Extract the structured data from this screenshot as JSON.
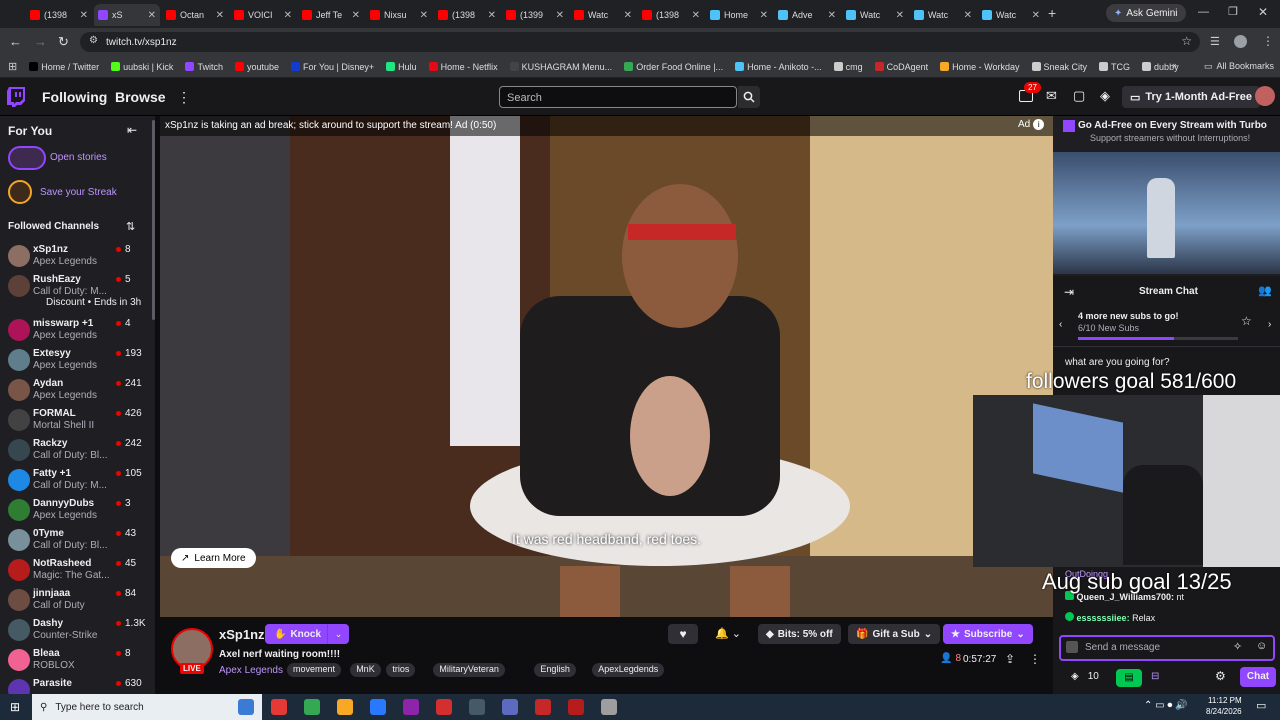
{
  "browser": {
    "tabs": [
      {
        "label": "(1398",
        "color": "#ff0000"
      },
      {
        "label": "xS",
        "color": "#9146ff",
        "active": true
      },
      {
        "label": "Octan",
        "color": "#ff0000"
      },
      {
        "label": "VOICI",
        "color": "#ff0000"
      },
      {
        "label": "Jeff Te",
        "color": "#ff0000"
      },
      {
        "label": "Nixsu",
        "color": "#ff0000"
      },
      {
        "label": "(1398",
        "color": "#ff0000"
      },
      {
        "label": "(1399",
        "color": "#ff0000"
      },
      {
        "label": "Watc",
        "color": "#ff0000"
      },
      {
        "label": "(1398",
        "color": "#ff0000"
      },
      {
        "label": "Home",
        "color": "#4fc3f7"
      },
      {
        "label": "Adve",
        "color": "#4fc3f7"
      },
      {
        "label": "Watc",
        "color": "#4fc3f7"
      },
      {
        "label": "Watc",
        "color": "#4fc3f7"
      },
      {
        "label": "Watc",
        "color": "#4fc3f7"
      }
    ],
    "ask_gemini": "Ask Gemini",
    "url": "twitch.tv/xsp1nz",
    "bookmarks": [
      {
        "label": "Home / Twitter",
        "color": "#000000"
      },
      {
        "label": "uubski | Kick",
        "color": "#53fc18"
      },
      {
        "label": "Twitch",
        "color": "#9146ff"
      },
      {
        "label": "youtube",
        "color": "#ff0000"
      },
      {
        "label": "For You | Disney+",
        "color": "#113ccf"
      },
      {
        "label": "Hulu",
        "color": "#1ce783"
      },
      {
        "label": "Home - Netflix",
        "color": "#e50914"
      },
      {
        "label": "KUSHAGRAM Menu...",
        "color": "#444444"
      },
      {
        "label": "Order Food Online |...",
        "color": "#34a853"
      },
      {
        "label": "Home - Anikoto -...",
        "color": "#4fc3f7"
      },
      {
        "label": "cmg",
        "color": "#cccccc"
      },
      {
        "label": "CoDAgent",
        "color": "#c62828"
      },
      {
        "label": "Home - Workday",
        "color": "#f9a825"
      },
      {
        "label": "Sneak City",
        "color": "#cccccc"
      },
      {
        "label": "TCG",
        "color": "#cccccc"
      },
      {
        "label": "dubby",
        "color": "#cccccc"
      }
    ],
    "all_bookmarks": "All Bookmarks"
  },
  "nav": {
    "following": "Following",
    "browse": "Browse",
    "search_placeholder": "Search",
    "notif_count": "27",
    "turbo": "Try 1-Month Ad-Free"
  },
  "sidebar": {
    "for_you": "For You",
    "open_stories": "Open stories",
    "save_streak": "Save your Streak",
    "followed": "Followed Channels",
    "channels": [
      {
        "name": "xSp1nz",
        "game": "Apex Legends",
        "viewers": "8",
        "color": "#8d6e63"
      },
      {
        "name": "RushEazy",
        "game": "Call of Duty: M...",
        "viewers": "5",
        "color": "#5d4037",
        "extra": "Discount • Ends in 3h"
      },
      {
        "name": "misswarp +1",
        "game": "Apex Legends",
        "viewers": "4",
        "color": "#ad1457"
      },
      {
        "name": "Extesyy",
        "game": "Apex Legends",
        "viewers": "193",
        "color": "#607d8b"
      },
      {
        "name": "Aydan",
        "game": "Apex Legends",
        "viewers": "241",
        "color": "#795548"
      },
      {
        "name": "FORMAL",
        "game": "Mortal Shell II",
        "viewers": "426",
        "color": "#424242"
      },
      {
        "name": "Rackzy",
        "game": "Call of Duty: Bl...",
        "viewers": "242",
        "color": "#37474f"
      },
      {
        "name": "Fatty +1",
        "game": "Call of Duty: M...",
        "viewers": "105",
        "color": "#1e88e5"
      },
      {
        "name": "DannyyDubs",
        "game": "Apex Legends",
        "viewers": "3",
        "color": "#2e7d32"
      },
      {
        "name": "0Tyme",
        "game": "Call of Duty: Bl...",
        "viewers": "43",
        "color": "#78909c"
      },
      {
        "name": "NotRasheed",
        "game": "Magic: The Gat...",
        "viewers": "45",
        "color": "#b71c1c"
      },
      {
        "name": "jinnjaaa",
        "game": "Call of Duty",
        "viewers": "84",
        "color": "#6d4c41"
      },
      {
        "name": "Dashy",
        "game": "Counter-Strike",
        "viewers": "1.3K",
        "color": "#455a64"
      },
      {
        "name": "Bleaa",
        "game": "ROBLOX",
        "viewers": "8",
        "color": "#f06292"
      },
      {
        "name": "Parasite",
        "game": "",
        "viewers": "630",
        "color": "#5e35b1"
      }
    ]
  },
  "video": {
    "ad_banner": "xSp1nz is taking an ad break; stick around to support the stream! Ad (0:50)",
    "ad_badge": "Ad",
    "subtitle": "It was red headband, red toes.",
    "learn_more": "Learn More"
  },
  "overlay": {
    "follower_goal": "followers goal 581/600",
    "sub_goal": "Aug sub goal 13/25"
  },
  "stream": {
    "channel": "xSp1nz",
    "knock": "Knock",
    "title": "Axel nerf waiting room!!!!",
    "game": "Apex Legends",
    "live": "LIVE",
    "tags": [
      "movement",
      "MnK",
      "trios",
      "MilitaryVeteran",
      "English",
      "ApexLegdends"
    ],
    "bits": "Bits: 5% off",
    "gift": "Gift a Sub",
    "subscribe": "Subscribe",
    "viewers": "8",
    "uptime": "0:57:27"
  },
  "chat": {
    "promo_title": "Go Ad-Free on Every Stream with Turbo",
    "promo_sub": "Support streamers without Interruptions!",
    "header": "Stream Chat",
    "subs_goal_title": "4 more new subs to go!",
    "subs_goal_progress": "6/10 New Subs",
    "subs_goal_fraction": 0.6,
    "messages": [
      {
        "user": "",
        "text": "what are you going for?"
      },
      {
        "user": "OutDoingg",
        "text": ""
      },
      {
        "user": "Queen_J_Williams700:",
        "text": "nt"
      },
      {
        "user": "essssssiiee:",
        "text": "Relax"
      }
    ],
    "input_placeholder": "Send a message",
    "points": "10",
    "chat_btn": "Chat"
  },
  "taskbar": {
    "search": "Type here to search",
    "time": "11:12 PM",
    "date": "8/24/2026"
  }
}
